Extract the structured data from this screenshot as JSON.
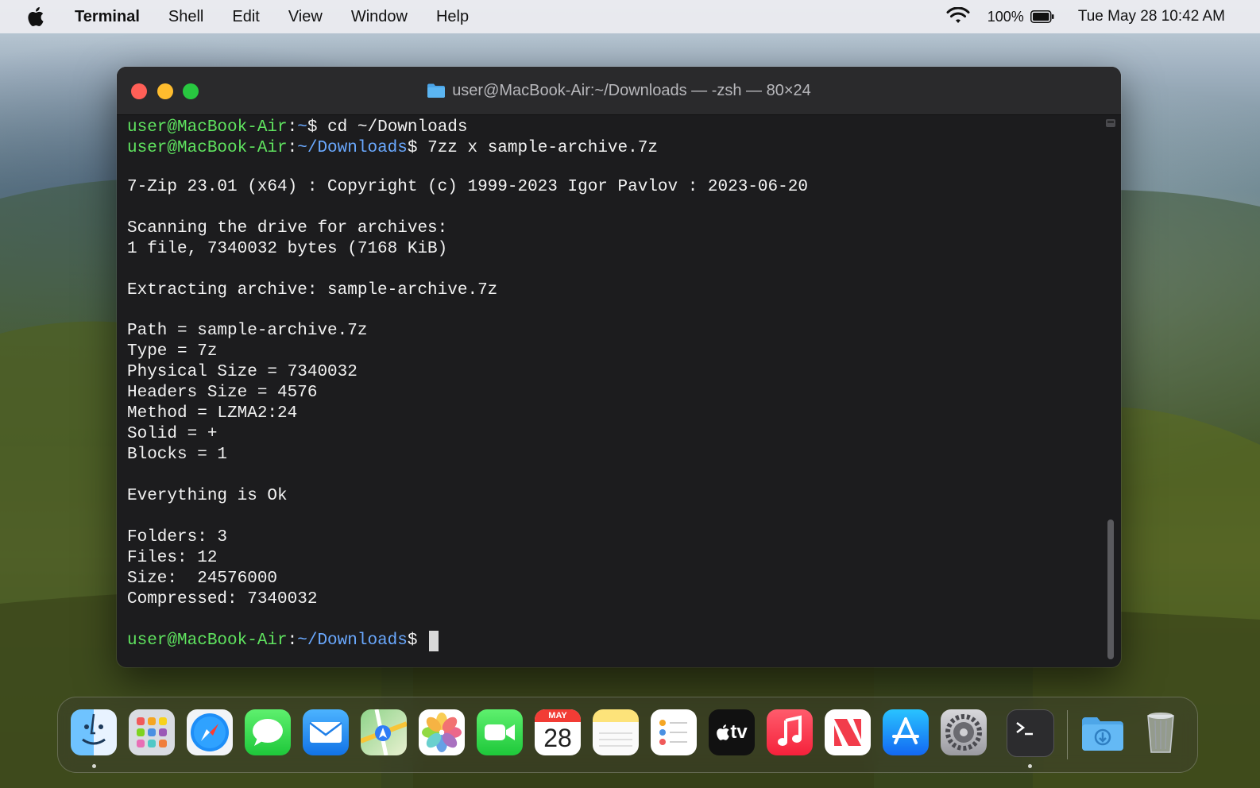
{
  "menubar": {
    "app_name": "Terminal",
    "menus": [
      "Shell",
      "Edit",
      "View",
      "Window",
      "Help"
    ],
    "battery_percent": "100%",
    "clock": "Tue May 28  10:42 AM"
  },
  "window": {
    "title": "user@MacBook-Air:~/Downloads — -zsh — 80×24"
  },
  "terminal": {
    "user_host": "user@MacBook-Air",
    "home_path": "~",
    "downloads_path": "~/Downloads",
    "cmd1": "cd ~/Downloads",
    "cmd2": "7zz x sample-archive.7z",
    "banner": "7-Zip 23.01 (x64) : Copyright (c) 1999-2023 Igor Pavlov : 2023-06-20",
    "scan1": "Scanning the drive for archives:",
    "scan2": "1 file, 7340032 bytes (7168 KiB)",
    "extracting": "Extracting archive: sample-archive.7z",
    "path": "Path = sample-archive.7z",
    "type": "Type = 7z",
    "physical_size": "Physical Size = 7340032",
    "headers_size": "Headers Size = 4576",
    "method": "Method = LZMA2:24",
    "solid": "Solid = +",
    "blocks": "Blocks = 1",
    "ok": "Everything is Ok",
    "folders": "Folders: 3",
    "files": "Files: 12",
    "size": "Size:  24576000",
    "compressed": "Compressed: 7340032"
  },
  "dock": {
    "items": [
      "Finder",
      "Launchpad",
      "Safari",
      "Messages",
      "Mail",
      "Maps",
      "Photos",
      "FaceTime",
      "Calendar",
      "Notes",
      "Reminders",
      "TV",
      "Music",
      "News",
      "App Store",
      "System Settings",
      "Terminal",
      "Downloads",
      "Trash"
    ],
    "calendar_month": "MAY",
    "calendar_day": "28",
    "tv_label": "tv"
  },
  "colors": {
    "prompt_user": "#5fe35f",
    "prompt_path": "#6aa9ff",
    "terminal_bg": "#1c1c1e"
  }
}
